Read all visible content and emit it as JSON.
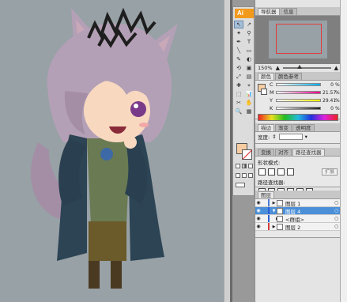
{
  "app": {
    "logo": "Ai"
  },
  "navigator": {
    "tabs": [
      "导航器",
      "信息"
    ],
    "zoom": "150%"
  },
  "color_panel": {
    "tabs": [
      "颜色",
      "颜色参考"
    ],
    "channels": [
      {
        "name": "C",
        "value": "0",
        "unit": "%",
        "color": "#00aeef"
      },
      {
        "name": "M",
        "value": "21.57",
        "unit": "%",
        "color": "#ec008c"
      },
      {
        "name": "Y",
        "value": "29.41",
        "unit": "%",
        "color": "#fff200"
      },
      {
        "name": "K",
        "value": "0",
        "unit": "%",
        "color": "#231f20"
      }
    ],
    "fill_color": "#f6cca2"
  },
  "stroke_panel": {
    "tabs": [
      "描边",
      "渐变",
      "透明度"
    ],
    "width_label": "宽度:"
  },
  "pathfinder_panel": {
    "tabs": [
      "变换",
      "对齐",
      "路径查找器"
    ],
    "shape_modes_label": "形状模式:",
    "expand_label": "扩展",
    "pathfinders_label": "路径查找器:"
  },
  "layers_panel": {
    "tabs": [
      "图层"
    ],
    "rows": [
      {
        "name": "图层 1",
        "color": "#4a7bd8"
      },
      {
        "name": "图层 4",
        "color": "#2b5fd8"
      },
      {
        "name": "<群组>",
        "color": "#2b5fd8"
      },
      {
        "name": "图层 2",
        "color": "#d43a3a"
      }
    ]
  },
  "toolbox": {
    "tools": [
      "↖",
      "↗",
      "✦",
      "⚲",
      "✒",
      "T",
      "╲",
      "▭",
      "✎",
      "◐",
      "⟲",
      "▣",
      "⤢",
      "▤",
      "✚",
      "⌖",
      "⬚",
      "📊",
      "✂",
      "✋",
      "🔍",
      "▦"
    ],
    "fill_color": "#f6cca2"
  },
  "canvas": {
    "background": "#97a1a6"
  }
}
